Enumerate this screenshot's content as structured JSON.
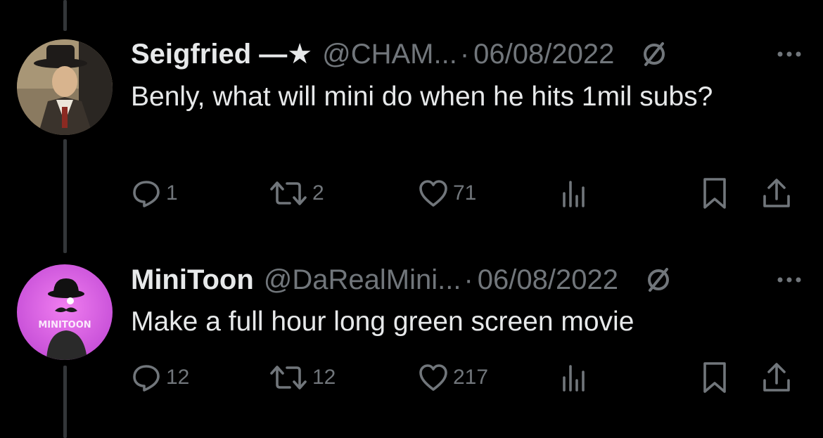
{
  "tweets": [
    {
      "display_name": "Seigfried —★",
      "handle": "@CHAM...",
      "separator": "·",
      "date": "06/08/2022",
      "text": "Benly, what will mini do when he hits 1mil subs?",
      "replies": "1",
      "reposts": "2",
      "likes": "71"
    },
    {
      "display_name": "MiniToon",
      "handle": "@DaRealMini...",
      "separator": "·",
      "date": "06/08/2022",
      "text": "Make a full hour long green screen movie",
      "replies": "12",
      "reposts": "12",
      "likes": "217",
      "avatar_text": "MINITOON"
    }
  ],
  "icons": [
    "reply-icon",
    "repost-icon",
    "like-icon",
    "views-icon",
    "bookmark-icon",
    "share-icon",
    "grok-icon",
    "more-icon"
  ],
  "colors": {
    "background": "#000000",
    "primary_text": "#e7e9ea",
    "secondary_text": "#71767b",
    "thread_line": "#333639",
    "avatar_pink": "#e85ce0"
  }
}
